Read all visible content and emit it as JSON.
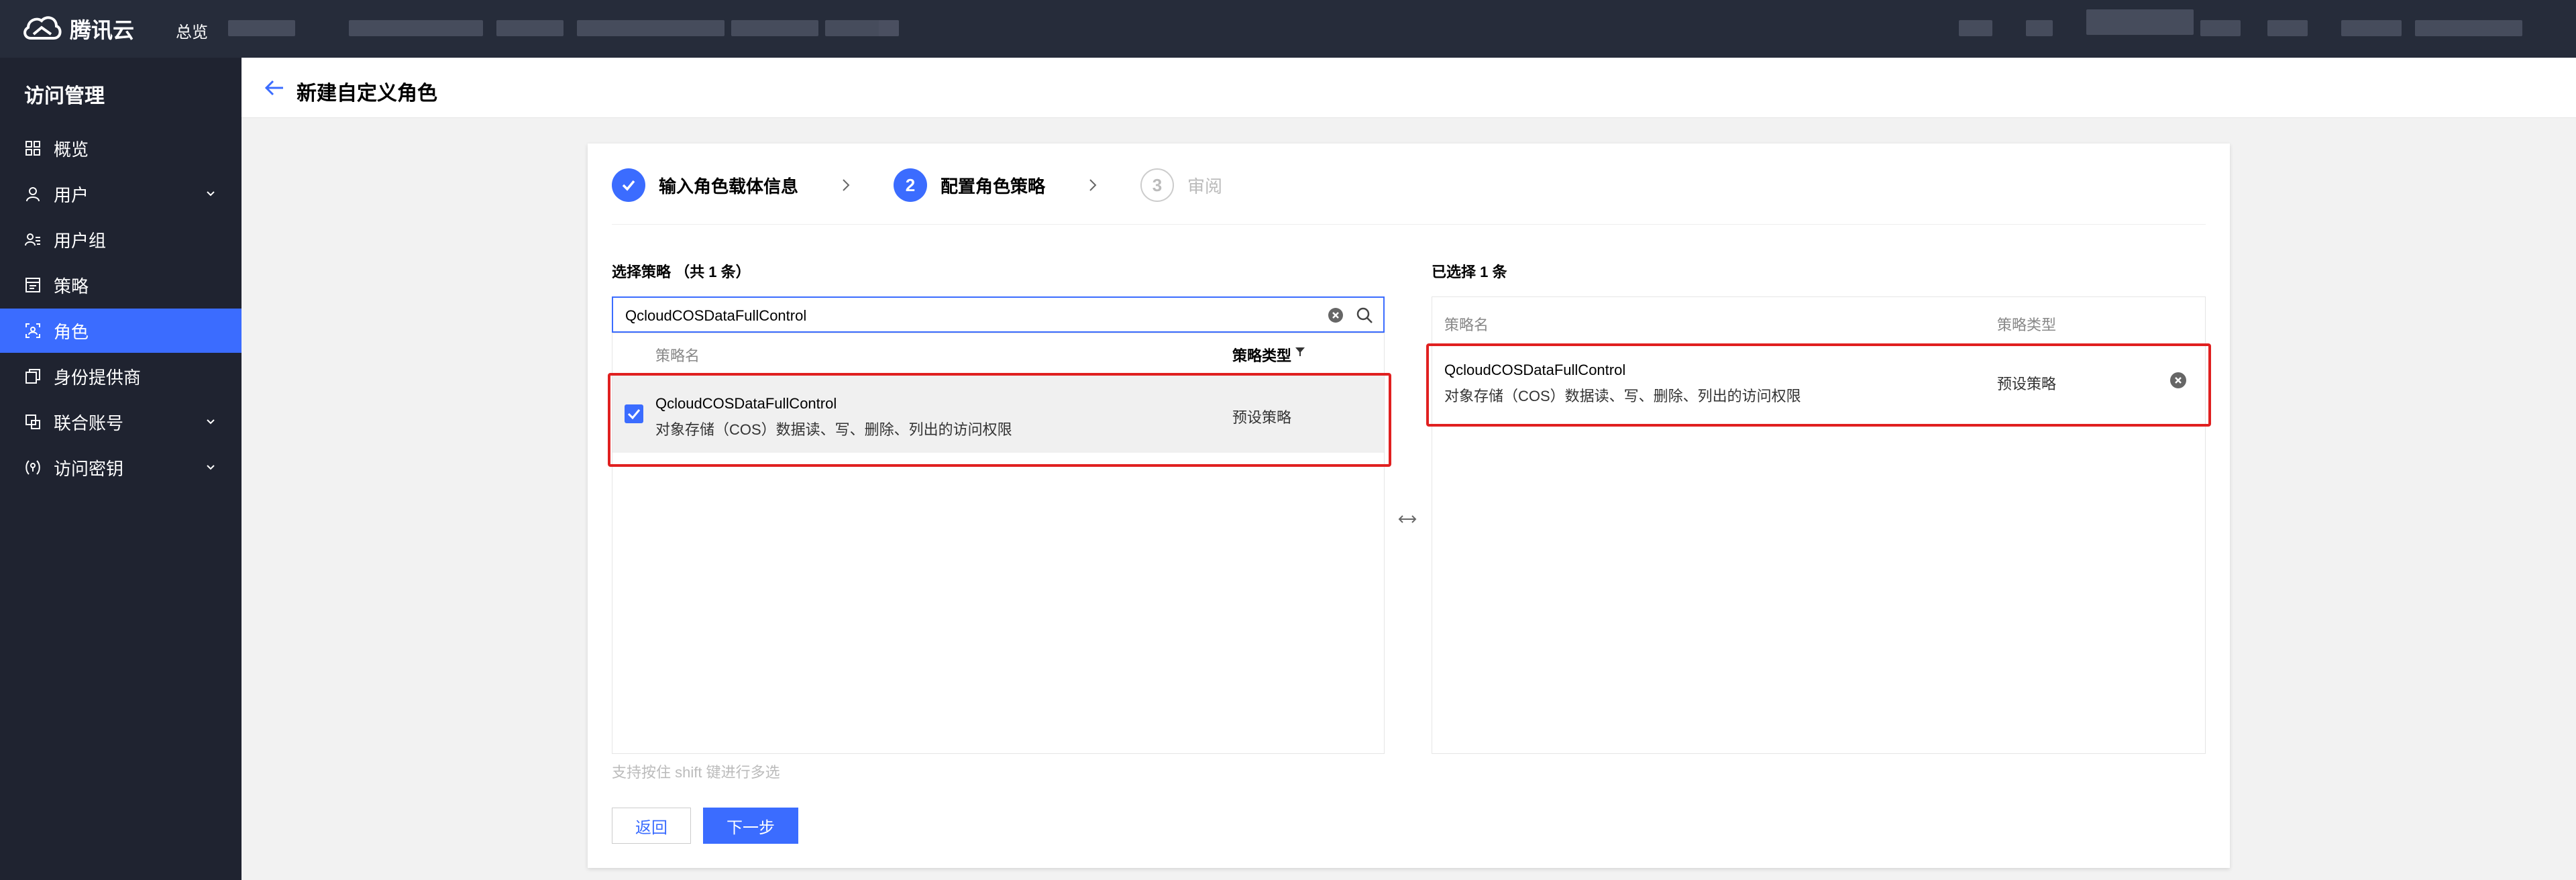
{
  "topnav": {
    "brand": "腾讯云",
    "overview": "总览"
  },
  "sidebar": {
    "title": "访问管理",
    "items": [
      {
        "label": "概览"
      },
      {
        "label": "用户"
      },
      {
        "label": "用户组"
      },
      {
        "label": "策略"
      },
      {
        "label": "角色"
      },
      {
        "label": "身份提供商"
      },
      {
        "label": "联合账号"
      },
      {
        "label": "访问密钥"
      }
    ],
    "active_index": 4
  },
  "page": {
    "title": "新建自定义角色"
  },
  "steps": [
    {
      "number": "1",
      "label": "输入角色载体信息",
      "state": "done"
    },
    {
      "number": "2",
      "label": "配置角色策略",
      "state": "current"
    },
    {
      "number": "3",
      "label": "审阅",
      "state": "todo"
    }
  ],
  "left": {
    "title": "选择策略 （共 1 条）",
    "search_value": "QcloudCOSDataFullControl",
    "col_name": "策略名",
    "col_type": "策略类型",
    "rows": [
      {
        "name": "QcloudCOSDataFullControl",
        "desc": "对象存储（COS）数据读、写、删除、列出的访问权限",
        "type": "预设策略",
        "checked": true
      }
    ],
    "hint": "支持按住 shift 键进行多选"
  },
  "right": {
    "title": "已选择 1 条",
    "col_name": "策略名",
    "col_type": "策略类型",
    "rows": [
      {
        "name": "QcloudCOSDataFullControl",
        "desc": "对象存储（COS）数据读、写、删除、列出的访问权限",
        "type": "预设策略"
      }
    ]
  },
  "buttons": {
    "back": "返回",
    "next": "下一步"
  },
  "colors": {
    "primary": "#3b6cff",
    "nav_bg": "#262c3a",
    "sidebar_bg": "#1f2330",
    "highlight": "#e02020"
  }
}
